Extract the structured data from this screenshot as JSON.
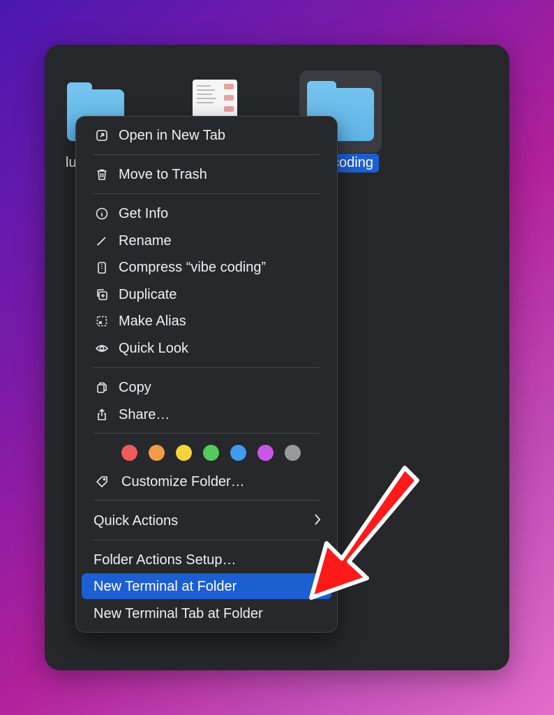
{
  "desktop": {
    "left_folder_label": "lu",
    "selected_folder_label": "coding"
  },
  "menu": {
    "open_new_tab": "Open in New Tab",
    "move_to_trash": "Move to Trash",
    "get_info": "Get Info",
    "rename": "Rename",
    "compress": "Compress “vibe coding”",
    "duplicate": "Duplicate",
    "make_alias": "Make Alias",
    "quick_look": "Quick Look",
    "copy": "Copy",
    "share": "Share…",
    "tag_colors": [
      "#f05a5a",
      "#f29a4a",
      "#f5d33d",
      "#52c95b",
      "#3e9bf2",
      "#c957e6",
      "#9a9a9e"
    ],
    "customize_folder": "Customize Folder…",
    "quick_actions": "Quick Actions",
    "folder_actions_setup": "Folder Actions Setup…",
    "new_terminal": "New Terminal at Folder",
    "new_terminal_tab": "New Terminal Tab at Folder"
  },
  "colors": {
    "highlight": "#1c5fd2",
    "arrow": "#ff1a1a",
    "menu_bg": "#26282c",
    "window_bg": "#25272b",
    "folder": "#6fc0ee"
  }
}
